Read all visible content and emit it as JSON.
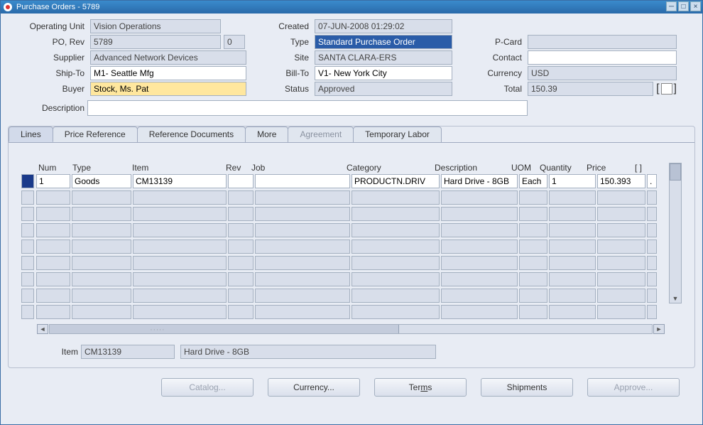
{
  "title": "Purchase Orders - 5789",
  "header": {
    "operating_unit_label": "Operating Unit",
    "operating_unit": "Vision Operations",
    "created_label": "Created",
    "created": "07-JUN-2008 01:29:02",
    "po_rev_label": "PO, Rev",
    "po": "5789",
    "rev": "0",
    "type_label": "Type",
    "type": "Standard Purchase Order",
    "pcard_label": "P-Card",
    "pcard": "",
    "supplier_label": "Supplier",
    "supplier": "Advanced Network Devices",
    "site_label": "Site",
    "site": "SANTA CLARA-ERS",
    "contact_label": "Contact",
    "contact": "",
    "shipto_label": "Ship-To",
    "shipto": "M1- Seattle Mfg",
    "billto_label": "Bill-To",
    "billto": "V1- New York City",
    "currency_label": "Currency",
    "currency": "USD",
    "buyer_label": "Buyer",
    "buyer": "Stock, Ms. Pat",
    "status_label": "Status",
    "status": "Approved",
    "total_label": "Total",
    "total": "150.39",
    "description_label": "Description",
    "description": ""
  },
  "tabs": {
    "lines": "Lines",
    "price_ref": "Price Reference",
    "ref_docs": "Reference Documents",
    "more": "More",
    "agreement": "Agreement",
    "temp_labor": "Temporary Labor"
  },
  "grid": {
    "headers": {
      "num": "Num",
      "type": "Type",
      "item": "Item",
      "rev": "Rev",
      "job": "Job",
      "category": "Category",
      "description": "Description",
      "uom": "UOM",
      "quantity": "Quantity",
      "price": "Price",
      "br": "[ ]"
    },
    "rows": [
      {
        "num": "1",
        "type": "Goods",
        "item": "CM13139",
        "rev": "",
        "job": "",
        "category": "PRODUCTN.DRIV",
        "description": "Hard Drive - 8GB",
        "uom": "Each",
        "quantity": "1",
        "price": "150.393",
        "br": "."
      }
    ]
  },
  "footer": {
    "item_label": "Item",
    "item_code": "CM13139",
    "item_desc": "Hard Drive - 8GB"
  },
  "buttons": {
    "catalog": "Catalog...",
    "currency": "Currency...",
    "terms": "Terms",
    "shipments": "Shipments",
    "approve": "Approve..."
  }
}
